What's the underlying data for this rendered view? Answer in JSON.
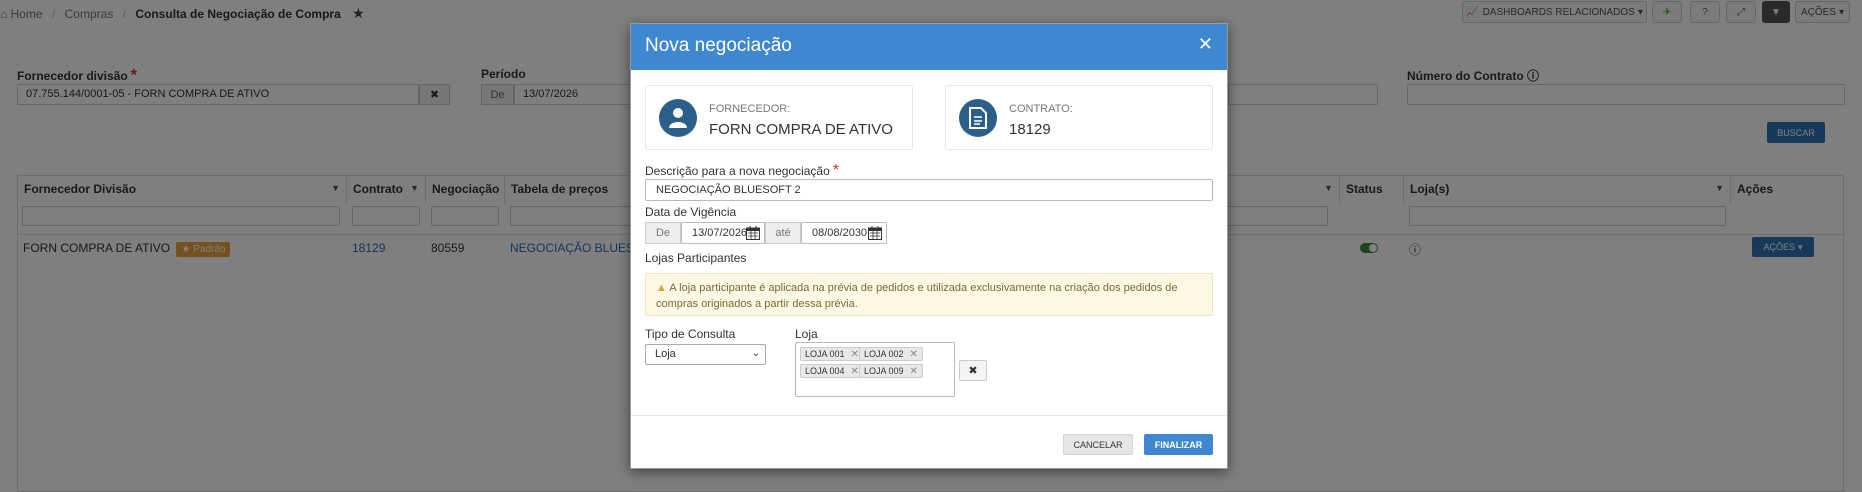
{
  "breadcrumb": {
    "home": "Home",
    "compras": "Compras",
    "current": "Consulta de Negociação de Compra",
    "star_icon": "star-icon"
  },
  "toolbar": {
    "dashboards": "DASHBOARDS RELACIONADOS",
    "acoes": "AÇÕES"
  },
  "filters": {
    "fornecedor_label": "Fornecedor divisão",
    "fornecedor_value": "07.755.144/0001-05 - FORN COMPRA DE ATIVO",
    "periodo_label": "Período",
    "periodo_de": "De",
    "periodo_value": "13/07/2026",
    "contrato_label": "Número do Contrato",
    "buscar": "BUSCAR"
  },
  "table": {
    "columns": [
      "Fornecedor Divisão",
      "Contrato",
      "Negociação",
      "Tabela de preços",
      "Status",
      "Loja(s)",
      "Ações"
    ],
    "row": {
      "fornecedor": "FORN COMPRA DE ATIVO",
      "badge": "Padrão",
      "contrato": "18129",
      "negociacao": "80559",
      "tabela": "NEGOCIAÇÃO BLUESOF",
      "acoes": "AÇÕES"
    }
  },
  "modal": {
    "title": "Nova negociação",
    "fornecedor_label": "FORNECEDOR:",
    "fornecedor_value": "FORN COMPRA DE ATIVO",
    "contrato_label": "CONTRATO:",
    "contrato_value": "18129",
    "descricao_label": "Descrição para a nova negociação",
    "descricao_value": "NEGOCIAÇÃO BLUESOFT 2",
    "vigencia_label": "Data de Vigência",
    "de_label": "De",
    "de_value": "13/07/2026",
    "ate_label": "até",
    "ate_value": "08/08/2030",
    "lojas_label": "Lojas Participantes",
    "warning": "A loja participante é aplicada na prévia de pedidos e utilizada exclusivamente na criação dos pedidos de compras originados a partir dessa prévia.",
    "tipo_label": "Tipo de Consulta",
    "tipo_value": "Loja",
    "loja_label": "Loja",
    "tags": [
      "LOJA 001",
      "LOJA 002",
      "LOJA 004",
      "LOJA 009"
    ],
    "cancelar": "CANCELAR",
    "finalizar": "FINALIZAR"
  },
  "colors": {
    "primary": "#3f88cf",
    "icon_circle": "#2b5f8a",
    "badge": "#e8a33d",
    "warning_bg": "#fcf8e3"
  }
}
